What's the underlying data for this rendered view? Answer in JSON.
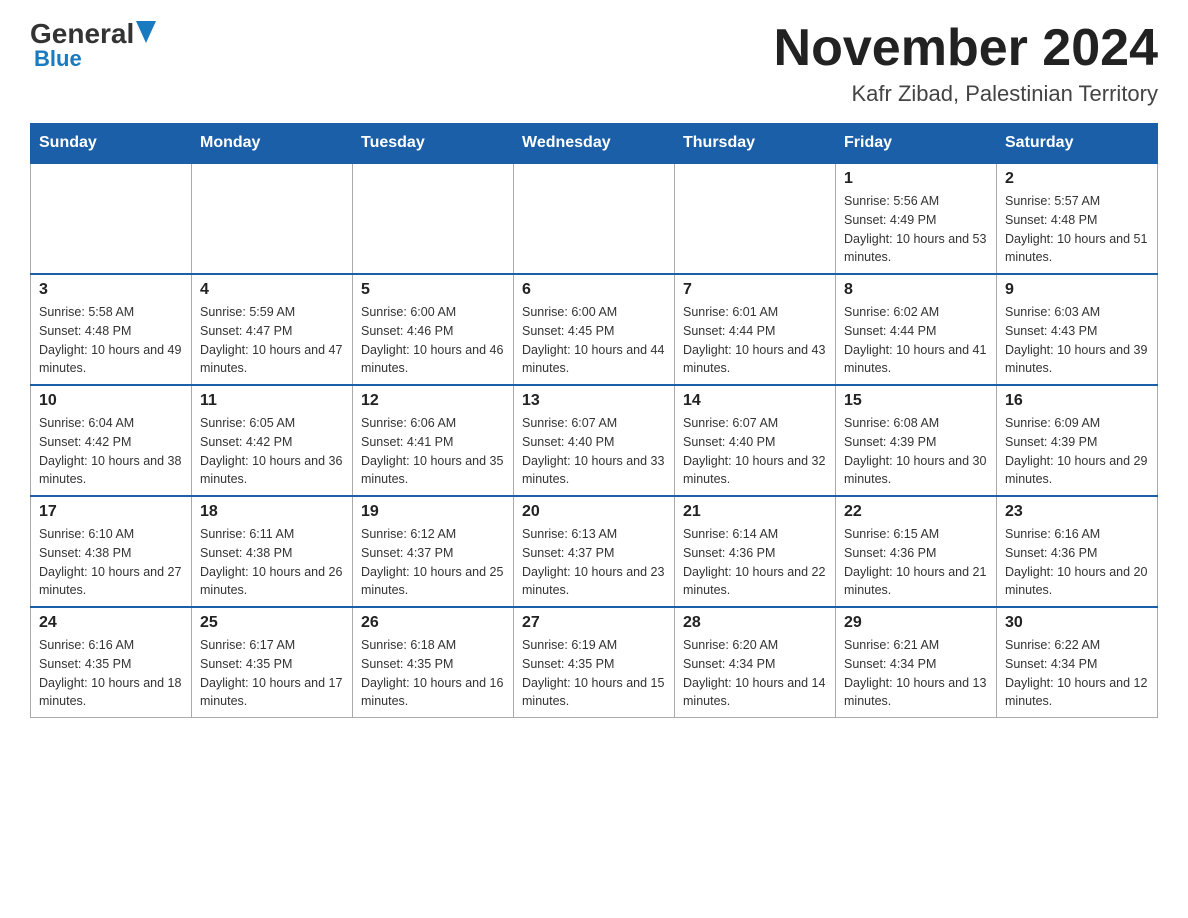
{
  "header": {
    "logo_general": "General",
    "logo_blue": "Blue",
    "month_title": "November 2024",
    "location": "Kafr Zibad, Palestinian Territory"
  },
  "weekdays": [
    "Sunday",
    "Monday",
    "Tuesday",
    "Wednesday",
    "Thursday",
    "Friday",
    "Saturday"
  ],
  "weeks": [
    {
      "days": [
        {
          "date": "",
          "sunrise": "",
          "sunset": "",
          "daylight": ""
        },
        {
          "date": "",
          "sunrise": "",
          "sunset": "",
          "daylight": ""
        },
        {
          "date": "",
          "sunrise": "",
          "sunset": "",
          "daylight": ""
        },
        {
          "date": "",
          "sunrise": "",
          "sunset": "",
          "daylight": ""
        },
        {
          "date": "",
          "sunrise": "",
          "sunset": "",
          "daylight": ""
        },
        {
          "date": "1",
          "sunrise": "Sunrise: 5:56 AM",
          "sunset": "Sunset: 4:49 PM",
          "daylight": "Daylight: 10 hours and 53 minutes."
        },
        {
          "date": "2",
          "sunrise": "Sunrise: 5:57 AM",
          "sunset": "Sunset: 4:48 PM",
          "daylight": "Daylight: 10 hours and 51 minutes."
        }
      ]
    },
    {
      "days": [
        {
          "date": "3",
          "sunrise": "Sunrise: 5:58 AM",
          "sunset": "Sunset: 4:48 PM",
          "daylight": "Daylight: 10 hours and 49 minutes."
        },
        {
          "date": "4",
          "sunrise": "Sunrise: 5:59 AM",
          "sunset": "Sunset: 4:47 PM",
          "daylight": "Daylight: 10 hours and 47 minutes."
        },
        {
          "date": "5",
          "sunrise": "Sunrise: 6:00 AM",
          "sunset": "Sunset: 4:46 PM",
          "daylight": "Daylight: 10 hours and 46 minutes."
        },
        {
          "date": "6",
          "sunrise": "Sunrise: 6:00 AM",
          "sunset": "Sunset: 4:45 PM",
          "daylight": "Daylight: 10 hours and 44 minutes."
        },
        {
          "date": "7",
          "sunrise": "Sunrise: 6:01 AM",
          "sunset": "Sunset: 4:44 PM",
          "daylight": "Daylight: 10 hours and 43 minutes."
        },
        {
          "date": "8",
          "sunrise": "Sunrise: 6:02 AM",
          "sunset": "Sunset: 4:44 PM",
          "daylight": "Daylight: 10 hours and 41 minutes."
        },
        {
          "date": "9",
          "sunrise": "Sunrise: 6:03 AM",
          "sunset": "Sunset: 4:43 PM",
          "daylight": "Daylight: 10 hours and 39 minutes."
        }
      ]
    },
    {
      "days": [
        {
          "date": "10",
          "sunrise": "Sunrise: 6:04 AM",
          "sunset": "Sunset: 4:42 PM",
          "daylight": "Daylight: 10 hours and 38 minutes."
        },
        {
          "date": "11",
          "sunrise": "Sunrise: 6:05 AM",
          "sunset": "Sunset: 4:42 PM",
          "daylight": "Daylight: 10 hours and 36 minutes."
        },
        {
          "date": "12",
          "sunrise": "Sunrise: 6:06 AM",
          "sunset": "Sunset: 4:41 PM",
          "daylight": "Daylight: 10 hours and 35 minutes."
        },
        {
          "date": "13",
          "sunrise": "Sunrise: 6:07 AM",
          "sunset": "Sunset: 4:40 PM",
          "daylight": "Daylight: 10 hours and 33 minutes."
        },
        {
          "date": "14",
          "sunrise": "Sunrise: 6:07 AM",
          "sunset": "Sunset: 4:40 PM",
          "daylight": "Daylight: 10 hours and 32 minutes."
        },
        {
          "date": "15",
          "sunrise": "Sunrise: 6:08 AM",
          "sunset": "Sunset: 4:39 PM",
          "daylight": "Daylight: 10 hours and 30 minutes."
        },
        {
          "date": "16",
          "sunrise": "Sunrise: 6:09 AM",
          "sunset": "Sunset: 4:39 PM",
          "daylight": "Daylight: 10 hours and 29 minutes."
        }
      ]
    },
    {
      "days": [
        {
          "date": "17",
          "sunrise": "Sunrise: 6:10 AM",
          "sunset": "Sunset: 4:38 PM",
          "daylight": "Daylight: 10 hours and 27 minutes."
        },
        {
          "date": "18",
          "sunrise": "Sunrise: 6:11 AM",
          "sunset": "Sunset: 4:38 PM",
          "daylight": "Daylight: 10 hours and 26 minutes."
        },
        {
          "date": "19",
          "sunrise": "Sunrise: 6:12 AM",
          "sunset": "Sunset: 4:37 PM",
          "daylight": "Daylight: 10 hours and 25 minutes."
        },
        {
          "date": "20",
          "sunrise": "Sunrise: 6:13 AM",
          "sunset": "Sunset: 4:37 PM",
          "daylight": "Daylight: 10 hours and 23 minutes."
        },
        {
          "date": "21",
          "sunrise": "Sunrise: 6:14 AM",
          "sunset": "Sunset: 4:36 PM",
          "daylight": "Daylight: 10 hours and 22 minutes."
        },
        {
          "date": "22",
          "sunrise": "Sunrise: 6:15 AM",
          "sunset": "Sunset: 4:36 PM",
          "daylight": "Daylight: 10 hours and 21 minutes."
        },
        {
          "date": "23",
          "sunrise": "Sunrise: 6:16 AM",
          "sunset": "Sunset: 4:36 PM",
          "daylight": "Daylight: 10 hours and 20 minutes."
        }
      ]
    },
    {
      "days": [
        {
          "date": "24",
          "sunrise": "Sunrise: 6:16 AM",
          "sunset": "Sunset: 4:35 PM",
          "daylight": "Daylight: 10 hours and 18 minutes."
        },
        {
          "date": "25",
          "sunrise": "Sunrise: 6:17 AM",
          "sunset": "Sunset: 4:35 PM",
          "daylight": "Daylight: 10 hours and 17 minutes."
        },
        {
          "date": "26",
          "sunrise": "Sunrise: 6:18 AM",
          "sunset": "Sunset: 4:35 PM",
          "daylight": "Daylight: 10 hours and 16 minutes."
        },
        {
          "date": "27",
          "sunrise": "Sunrise: 6:19 AM",
          "sunset": "Sunset: 4:35 PM",
          "daylight": "Daylight: 10 hours and 15 minutes."
        },
        {
          "date": "28",
          "sunrise": "Sunrise: 6:20 AM",
          "sunset": "Sunset: 4:34 PM",
          "daylight": "Daylight: 10 hours and 14 minutes."
        },
        {
          "date": "29",
          "sunrise": "Sunrise: 6:21 AM",
          "sunset": "Sunset: 4:34 PM",
          "daylight": "Daylight: 10 hours and 13 minutes."
        },
        {
          "date": "30",
          "sunrise": "Sunrise: 6:22 AM",
          "sunset": "Sunset: 4:34 PM",
          "daylight": "Daylight: 10 hours and 12 minutes."
        }
      ]
    }
  ]
}
